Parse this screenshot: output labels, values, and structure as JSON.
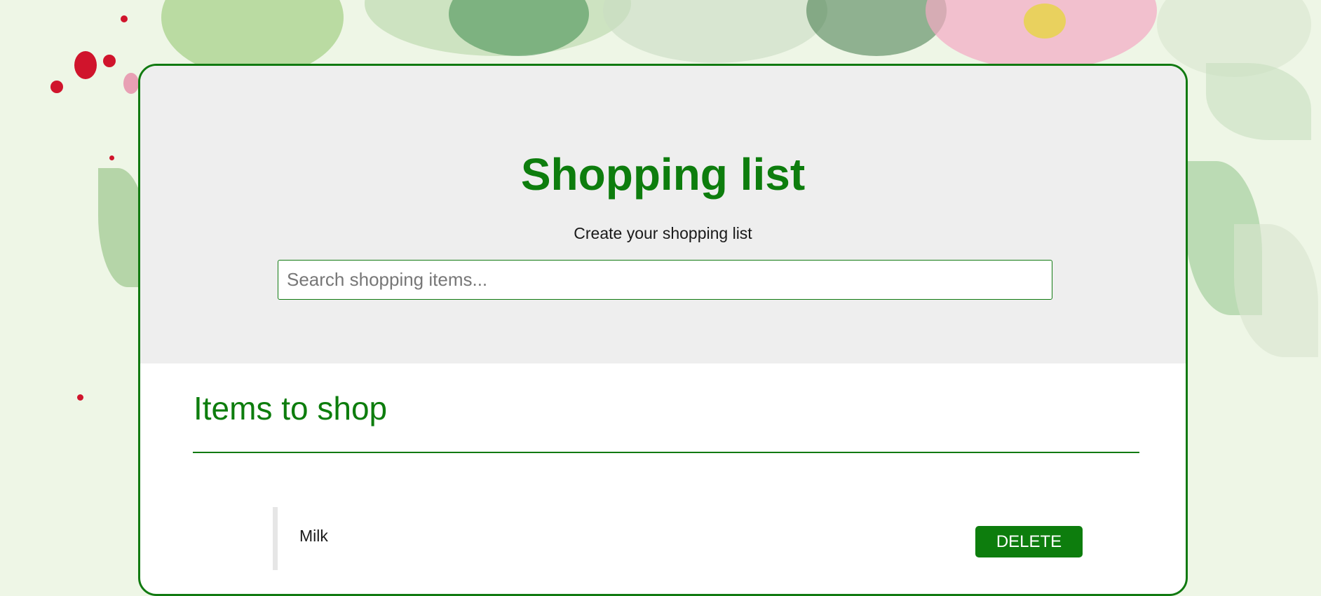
{
  "header": {
    "title": "Shopping list",
    "subtitle": "Create your shopping list"
  },
  "search": {
    "placeholder": "Search shopping items...",
    "value": ""
  },
  "items_section": {
    "title": "Items to shop",
    "items": [
      {
        "name": "Milk",
        "delete_label": "DELETE"
      }
    ]
  },
  "colors": {
    "accent": "#0d7d0d",
    "header_bg": "#eeeeee",
    "page_bg": "#eef6e6"
  }
}
